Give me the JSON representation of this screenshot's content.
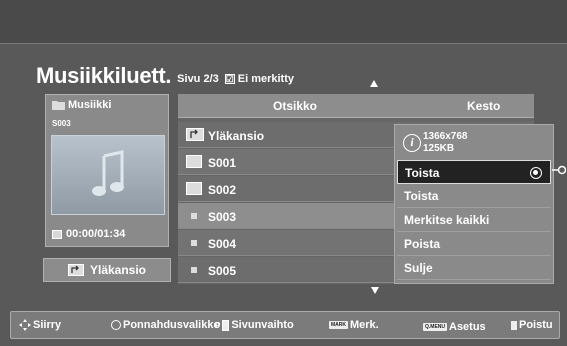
{
  "header": {
    "title": "Musiikkiluett.",
    "page_indicator": "Sivu 2/3",
    "unmarked_label": "Ei merkitty",
    "checkbox_glyph": "☑"
  },
  "left_panel": {
    "folder_label": "Musiikki",
    "code": "S003",
    "time": "00:00/01:34",
    "thumbnail_icon": "music-note-icon"
  },
  "up_folder_button": "Yläkansio",
  "list": {
    "columns": {
      "title": "Otsikko",
      "duration": "Kesto"
    },
    "rows": [
      {
        "label": "Yläkansio",
        "type": "up-folder"
      },
      {
        "label": "S001",
        "type": "folder"
      },
      {
        "label": "S002",
        "type": "folder"
      },
      {
        "label": "S003",
        "type": "file",
        "selected": true
      },
      {
        "label": "S004",
        "type": "file"
      },
      {
        "label": "S005",
        "type": "file"
      }
    ]
  },
  "popup": {
    "resolution": "1366x768",
    "size": "125KB",
    "info_icon_glyph": "i",
    "items": [
      {
        "label": "Toista",
        "active": true
      },
      {
        "label": "Toista"
      },
      {
        "label": "Merkitse kaikki"
      },
      {
        "label": "Poista"
      },
      {
        "label": "Sulje"
      }
    ]
  },
  "footer": {
    "move": "Siirry",
    "popup_menu": "Ponnahdusvalikko",
    "p_key": "P",
    "page_change": "Sivunvaihto",
    "mark_key": "MARK",
    "mark": "Merk.",
    "qmenu_key": "Q.MENU",
    "settings": "Asetus",
    "exit": "Poistu"
  },
  "colors": {
    "background": "#595959",
    "panel": "#8a8a8a",
    "active_item": "#222222",
    "text": "#ffffff"
  }
}
